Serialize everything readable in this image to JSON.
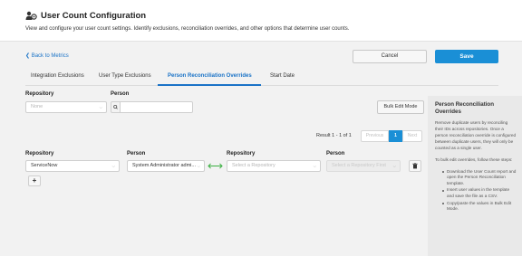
{
  "header": {
    "title": "User Count Configuration",
    "subtitle": "View and configure your user count settings. Identify exclusions, reconciliation overrides, and other options that determine user counts."
  },
  "actions": {
    "back_label": "Back to Metrics",
    "cancel_label": "Cancel",
    "save_label": "Save"
  },
  "tabs": [
    {
      "label": "Integration Exclusions",
      "active": false
    },
    {
      "label": "User Type Exclusions",
      "active": false
    },
    {
      "label": "Person Reconciliation Overrides",
      "active": true
    },
    {
      "label": "Start Date",
      "active": false
    }
  ],
  "filters": {
    "repository_label": "Repository",
    "repository_placeholder": "None",
    "person_label": "Person",
    "person_value": "",
    "bulk_edit_label": "Bulk Edit Mode"
  },
  "pagination": {
    "result_text": "Result 1 - 1 of 1",
    "previous_label": "Previous",
    "current_page": "1",
    "next_label": "Next"
  },
  "override_row": {
    "headers": {
      "left_repository": "Repository",
      "left_person": "Person",
      "right_repository": "Repository",
      "right_person": "Person"
    },
    "left_repository_value": "ServiceNow",
    "left_person_value": "System Administrator admi...",
    "right_repository_placeholder": "Select a Repository",
    "right_person_placeholder": "Select a Repository First",
    "add_label": "+"
  },
  "sidebar": {
    "title": "Person Reconciliation Overrides",
    "paragraph1": "Remove duplicate users by reconciling their IDs across repositories. Once a person reconciliation override is configured between duplicate users, they will only be counted as a single user.",
    "paragraph2": "To bulk edit overrides, follow these steps:",
    "steps": [
      "Download the User Count report and open the Person Reconciliation template.",
      "Insert user values in the template and save the file as a CSV.",
      "Copy/paste the values in Bulk Edit Mode."
    ]
  },
  "colors": {
    "accent": "#1a8fd6",
    "link": "#1a73c7",
    "link_arrow": "#3cb043"
  },
  "icons": {
    "title": "users-gear-icon",
    "back": "chevron-left-icon",
    "search": "search-icon",
    "link": "double-arrow-icon",
    "delete": "trash-icon",
    "dropdown": "chevron-down-icon"
  }
}
